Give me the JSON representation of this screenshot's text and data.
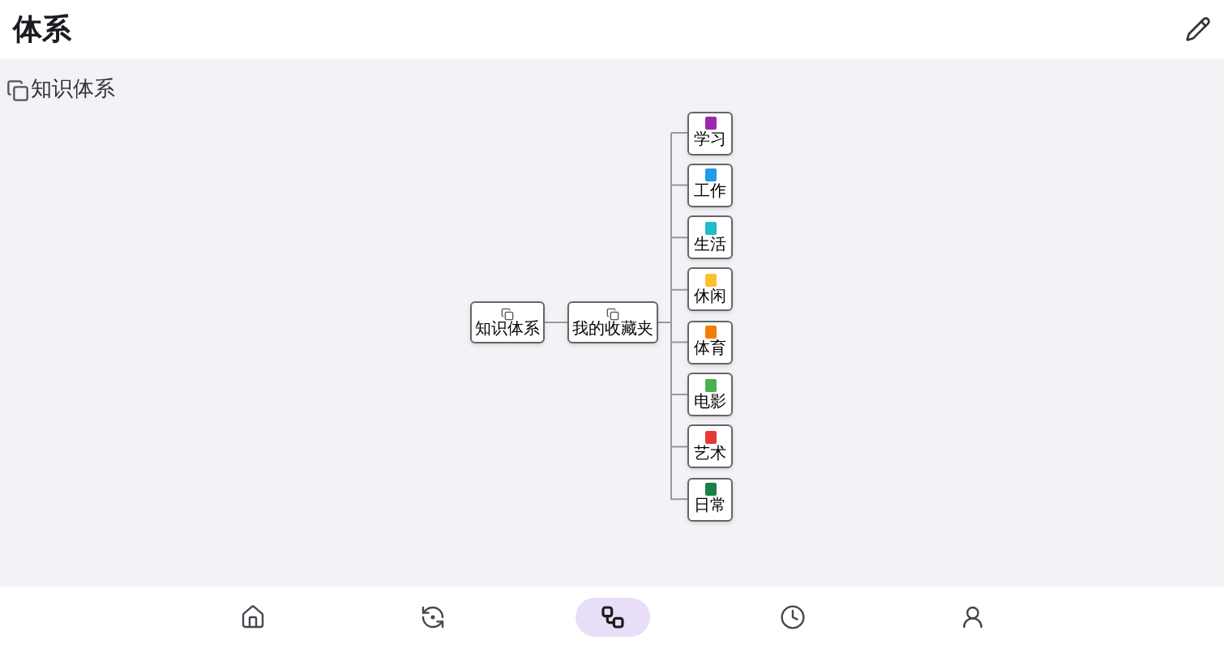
{
  "header": {
    "title": "体系"
  },
  "section": {
    "title": "知识体系"
  },
  "tree": {
    "label": "知识体系",
    "children": [
      {
        "label": "我的收藏夹",
        "children": [
          {
            "label": "学习",
            "color": "#9c27b0"
          },
          {
            "label": "工作",
            "color": "#1e9be9"
          },
          {
            "label": "生活",
            "color": "#1fbcc9"
          },
          {
            "label": "休闲",
            "color": "#fbc02d"
          },
          {
            "label": "体育",
            "color": "#f57c00"
          },
          {
            "label": "电影",
            "color": "#4caf50"
          },
          {
            "label": "艺术",
            "color": "#e53935"
          },
          {
            "label": "日常",
            "color": "#1b7f4a"
          }
        ]
      }
    ]
  },
  "nav": [
    {
      "kind": "home",
      "selected": false
    },
    {
      "kind": "sync",
      "selected": false
    },
    {
      "kind": "tree",
      "selected": true
    },
    {
      "kind": "history",
      "selected": false
    },
    {
      "kind": "profile",
      "selected": false
    }
  ]
}
